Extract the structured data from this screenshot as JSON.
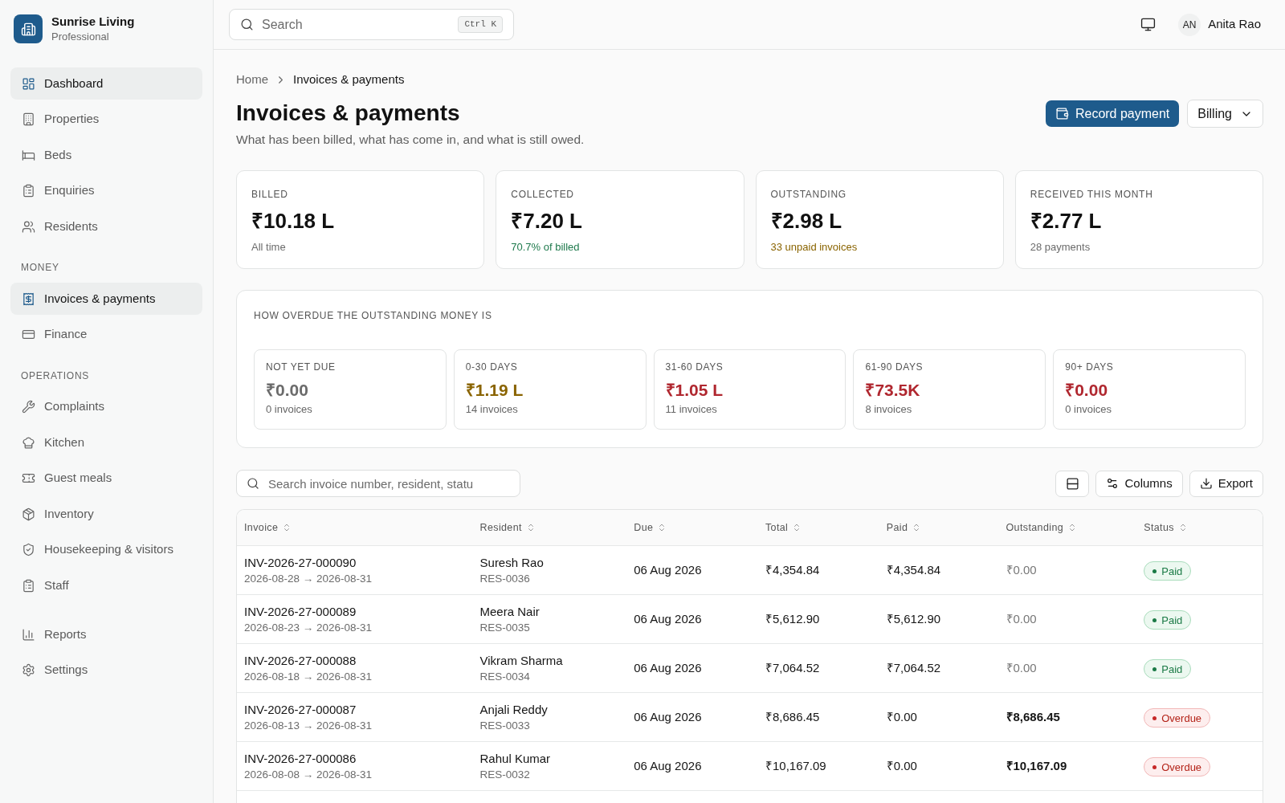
{
  "sidebar": {
    "brand": {
      "name": "Sunrise Living",
      "plan": "Professional"
    },
    "sections": [
      {
        "items": [
          {
            "label": "Dashboard",
            "selected": true
          },
          {
            "label": "Properties",
            "selected": false
          },
          {
            "label": "Beds",
            "selected": false
          },
          {
            "label": "Enquiries",
            "selected": false
          },
          {
            "label": "Residents",
            "selected": false
          }
        ]
      },
      {
        "heading": "MONEY",
        "items": [
          {
            "label": "Invoices & payments",
            "selected": true
          },
          {
            "label": "Finance",
            "selected": false
          }
        ]
      },
      {
        "heading": "OPERATIONS",
        "items": [
          {
            "label": "Complaints",
            "selected": false
          },
          {
            "label": "Kitchen",
            "selected": false
          },
          {
            "label": "Guest meals",
            "selected": false
          },
          {
            "label": "Inventory",
            "selected": false
          },
          {
            "label": "Housekeeping & visitors",
            "selected": false
          },
          {
            "label": "Staff",
            "selected": false
          }
        ]
      },
      {
        "items": [
          {
            "label": "Reports",
            "selected": false
          },
          {
            "label": "Settings",
            "selected": false
          }
        ]
      }
    ]
  },
  "topbar": {
    "search": {
      "placeholder": "Search",
      "shortcut": "Ctrl K"
    },
    "user": {
      "initials": "AN",
      "name": "Anita Rao"
    }
  },
  "breadcrumb": [
    "Home",
    "Invoices & payments"
  ],
  "page": {
    "title": "Invoices & payments",
    "subtitle": "What has been billed, what has come in, and what is still owed.",
    "primary_action": "Record payment",
    "menu_action": "Billing"
  },
  "stats": [
    {
      "label": "BILLED",
      "value": "₹10.18 L",
      "note": "All time",
      "color": "#6b6b6b"
    },
    {
      "label": "COLLECTED",
      "value": "₹7.20 L",
      "note": "70.7% of billed",
      "color": "#1f7a4d"
    },
    {
      "label": "OUTSTANDING",
      "value": "₹2.98 L",
      "note": "33 unpaid invoices",
      "color": "#8a6400"
    },
    {
      "label": "RECEIVED THIS MONTH",
      "value": "₹2.77 L",
      "note": "28 payments",
      "color": "#6b6b6b"
    }
  ],
  "aging": {
    "title": "HOW OVERDUE THE OUTSTANDING MONEY IS",
    "buckets": [
      {
        "label": "NOT YET DUE",
        "value": "₹0.00",
        "count": "0 invoices",
        "color": "#6b6b6b"
      },
      {
        "label": "0-30 DAYS",
        "value": "₹1.19 L",
        "count": "14 invoices",
        "color": "#8a6400"
      },
      {
        "label": "31-60 DAYS",
        "value": "₹1.05 L",
        "count": "11 invoices",
        "color": "#b0272f"
      },
      {
        "label": "61-90 DAYS",
        "value": "₹73.5K",
        "count": "8 invoices",
        "color": "#b0272f"
      },
      {
        "label": "90+ DAYS",
        "value": "₹0.00",
        "count": "0 invoices",
        "color": "#b0272f"
      }
    ]
  },
  "invoices": {
    "search": {
      "placeholder": "Search invoice number, resident, statu"
    },
    "buttons": [
      "Columns",
      "Export"
    ],
    "columns": [
      "Invoice",
      "Resident",
      "Due",
      "Total",
      "Paid",
      "Outstanding",
      "Status"
    ],
    "rows": [
      {
        "invoice": "INV-2026-27-000090",
        "period": "2026-08-28 → 2026-08-31",
        "resident": "Suresh Rao",
        "resident_id": "RES-0036",
        "due": "06 Aug 2026",
        "total": "₹4,354.84",
        "paid": "₹4,354.84",
        "outstanding": {
          "value": "₹0.00",
          "settled": true
        },
        "status": {
          "label": "Paid",
          "kind": "paid"
        }
      },
      {
        "invoice": "INV-2026-27-000089",
        "period": "2026-08-23 → 2026-08-31",
        "resident": "Meera Nair",
        "resident_id": "RES-0035",
        "due": "06 Aug 2026",
        "total": "₹5,612.90",
        "paid": "₹5,612.90",
        "outstanding": {
          "value": "₹0.00",
          "settled": true
        },
        "status": {
          "label": "Paid",
          "kind": "paid"
        }
      },
      {
        "invoice": "INV-2026-27-000088",
        "period": "2026-08-18 → 2026-08-31",
        "resident": "Vikram Sharma",
        "resident_id": "RES-0034",
        "due": "06 Aug 2026",
        "total": "₹7,064.52",
        "paid": "₹7,064.52",
        "outstanding": {
          "value": "₹0.00",
          "settled": true
        },
        "status": {
          "label": "Paid",
          "kind": "paid"
        }
      },
      {
        "invoice": "INV-2026-27-000087",
        "period": "2026-08-13 → 2026-08-31",
        "resident": "Anjali Reddy",
        "resident_id": "RES-0033",
        "due": "06 Aug 2026",
        "total": "₹8,686.45",
        "paid": "₹0.00",
        "outstanding": {
          "value": "₹8,686.45",
          "settled": false
        },
        "status": {
          "label": "Overdue",
          "kind": "overdue"
        }
      },
      {
        "invoice": "INV-2026-27-000086",
        "period": "2026-08-08 → 2026-08-31",
        "resident": "Rahul Kumar",
        "resident_id": "RES-0032",
        "due": "06 Aug 2026",
        "total": "₹10,167.09",
        "paid": "₹0.00",
        "outstanding": {
          "value": "₹10,167.09",
          "settled": false
        },
        "status": {
          "label": "Overdue",
          "kind": "overdue"
        }
      }
    ]
  }
}
